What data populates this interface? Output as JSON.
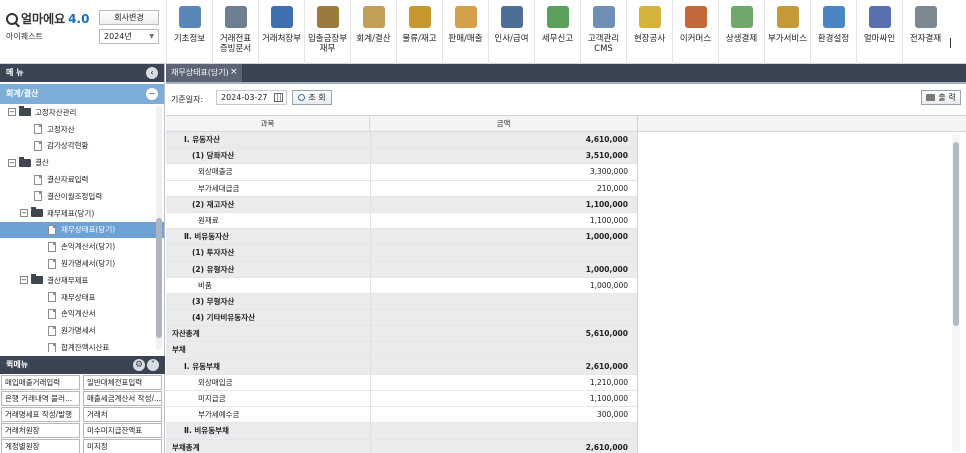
{
  "header": {
    "logo_text": "얼마에요",
    "logo_version": "4.0",
    "user_name": "아이퀘스트",
    "company_button": "회사변경",
    "year_select": "2024년"
  },
  "menu": [
    {
      "label": "기초정보",
      "icon": "settings-doc-icon",
      "color": "#5b86b8"
    },
    {
      "label": "거래전표\n증빙문서",
      "icon": "voucher-icon",
      "color": "#6e7f92"
    },
    {
      "label": "거래처장부",
      "icon": "ledger-book-icon",
      "color": "#3f6fb0"
    },
    {
      "label": "입출금장부\n재무",
      "icon": "money-bag-icon",
      "color": "#9a7a3d"
    },
    {
      "label": "회계/결산",
      "icon": "clipboard-icon",
      "color": "#c29f55"
    },
    {
      "label": "물류/재고",
      "icon": "forklift-box-icon",
      "color": "#c8962e"
    },
    {
      "label": "판매/매출",
      "icon": "sales-doc-icon",
      "color": "#d4a14a"
    },
    {
      "label": "인사/급여",
      "icon": "person-icon",
      "color": "#4d6e96"
    },
    {
      "label": "세무신고",
      "icon": "tax-calc-icon",
      "color": "#5aa05a"
    },
    {
      "label": "고객관리\nCMS",
      "icon": "customers-icon",
      "color": "#6f8fb6"
    },
    {
      "label": "현장공사",
      "icon": "excavator-icon",
      "color": "#d4b43a"
    },
    {
      "label": "이커머스",
      "icon": "shop-icon",
      "color": "#c46a3a"
    },
    {
      "label": "상생결제",
      "icon": "payment-card-icon",
      "color": "#6fa86a"
    },
    {
      "label": "부가서비스",
      "icon": "bank-icon",
      "color": "#c59b3a"
    },
    {
      "label": "환경설정",
      "icon": "gear-icon",
      "color": "#4a86c6"
    },
    {
      "label": "얼마싸인",
      "icon": "signature-icon",
      "color": "#5a6fb0"
    },
    {
      "label": "전자결재",
      "icon": "approval-icon",
      "color": "#7d8892"
    }
  ],
  "sidebar": {
    "title": "메 뉴",
    "section": "회계/결산",
    "tree": [
      {
        "label": "고정자산관리",
        "level": 0,
        "type": "folder",
        "toggle": "−"
      },
      {
        "label": "고정자산",
        "level": 1,
        "type": "doc"
      },
      {
        "label": "감가상각현황",
        "level": 1,
        "type": "doc"
      },
      {
        "label": "결산",
        "level": 0,
        "type": "folder",
        "toggle": "−"
      },
      {
        "label": "결산자료입력",
        "level": 1,
        "type": "doc"
      },
      {
        "label": "결산이월조정입력",
        "level": 1,
        "type": "doc"
      },
      {
        "label": "재무제표(당기)",
        "level": 1,
        "type": "folder",
        "toggle": "−"
      },
      {
        "label": "재무상태표(당기)",
        "level": 2,
        "type": "doc",
        "selected": true
      },
      {
        "label": "손익계산서(당기)",
        "level": 2,
        "type": "doc"
      },
      {
        "label": "원가명세서(당기)",
        "level": 2,
        "type": "doc"
      },
      {
        "label": "결산재무제표",
        "level": 1,
        "type": "folder",
        "toggle": "−"
      },
      {
        "label": "재무상태표",
        "level": 2,
        "type": "doc"
      },
      {
        "label": "손익계산서",
        "level": 2,
        "type": "doc"
      },
      {
        "label": "원가명세서",
        "level": 2,
        "type": "doc"
      },
      {
        "label": "합계잔액시산표",
        "level": 2,
        "type": "doc"
      }
    ]
  },
  "quick": {
    "title": "퀵메뉴",
    "items": [
      "매입매출거래입력",
      "일반대체전표입력",
      "은행 거래내역 불러...",
      "매출세금계산서 작성/...",
      "거래명세표 작성/발행",
      "거래처",
      "거래처원장",
      "미수미지급잔액표",
      "계정별원장",
      "미지정"
    ]
  },
  "tab": {
    "label": "재무상태표(당기)",
    "close": "×"
  },
  "toolbar": {
    "date_label": "기준일자:",
    "date_value": "2024-03-27",
    "search_label": "조 회",
    "print_label": "출 력"
  },
  "grid": {
    "headers": [
      "과목",
      "금액"
    ],
    "rows": [
      {
        "name": "Ⅰ. 유동자산",
        "indent": 1,
        "amount": "4,610,000",
        "bold": true
      },
      {
        "name": "(1) 당좌자산",
        "indent": 2,
        "amount": "3,510,000",
        "bold": true
      },
      {
        "name": "외상매출금",
        "indent": 3,
        "amount": "3,300,000",
        "bold": false
      },
      {
        "name": "부가세대급금",
        "indent": 3,
        "amount": "210,000",
        "bold": false
      },
      {
        "name": "(2) 재고자산",
        "indent": 2,
        "amount": "1,100,000",
        "bold": true
      },
      {
        "name": "원재료",
        "indent": 3,
        "amount": "1,100,000",
        "bold": false
      },
      {
        "name": "Ⅱ. 비유동자산",
        "indent": 1,
        "amount": "1,000,000",
        "bold": true
      },
      {
        "name": "(1) 투자자산",
        "indent": 2,
        "amount": "",
        "bold": true
      },
      {
        "name": "(2) 유형자산",
        "indent": 2,
        "amount": "1,000,000",
        "bold": true
      },
      {
        "name": "비품",
        "indent": 3,
        "amount": "1,000,000",
        "bold": false
      },
      {
        "name": "(3) 무형자산",
        "indent": 2,
        "amount": "",
        "bold": true
      },
      {
        "name": "(4) 기타비유동자산",
        "indent": 2,
        "amount": "",
        "bold": true
      },
      {
        "name": "자산총계",
        "indent": 0,
        "amount": "5,610,000",
        "bold": true
      },
      {
        "name": "부채",
        "indent": 0,
        "amount": "",
        "bold": true
      },
      {
        "name": "Ⅰ. 유동부채",
        "indent": 1,
        "amount": "2,610,000",
        "bold": true
      },
      {
        "name": "외상매입금",
        "indent": 3,
        "amount": "1,210,000",
        "bold": false
      },
      {
        "name": "미지급금",
        "indent": 3,
        "amount": "1,100,000",
        "bold": false
      },
      {
        "name": "부가세예수금",
        "indent": 3,
        "amount": "300,000",
        "bold": false
      },
      {
        "name": "Ⅱ. 비유동부채",
        "indent": 1,
        "amount": "",
        "bold": true
      },
      {
        "name": "부채총계",
        "indent": 0,
        "amount": "2,610,000",
        "bold": true
      }
    ]
  }
}
